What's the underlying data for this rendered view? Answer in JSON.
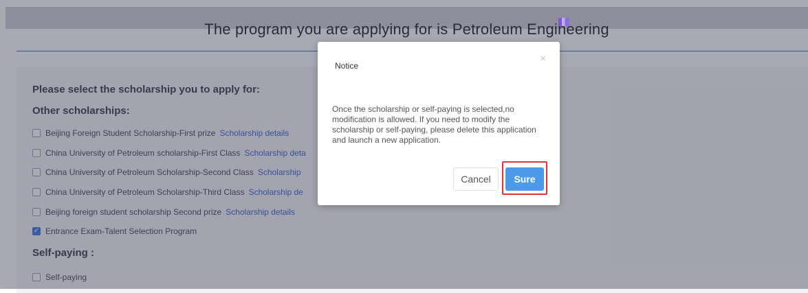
{
  "header": {
    "program_title": "The program you are applying for is Petroleum Engineering"
  },
  "form": {
    "prompt": "Please select the scholarship you to apply for:",
    "other_scholarships_heading": "Other scholarships:",
    "options": [
      {
        "label": "Beijing Foreign Student Scholarship-First prize",
        "link": "Scholarship details",
        "checked": false
      },
      {
        "label": "China University of Petroleum scholarship-First Class",
        "link": "Scholarship deta",
        "checked": false
      },
      {
        "label": "China University of Petroleum Scholarship-Second Class",
        "link": "Scholarship",
        "checked": false
      },
      {
        "label": "China University of Petroleum Scholarship-Third Class",
        "link": "Scholarship de",
        "checked": false
      },
      {
        "label": "Beijing foreign student scholarship Second prize",
        "link": "Scholarship details",
        "checked": false
      },
      {
        "label": "Entrance Exam-Talent Selection Program",
        "link": "",
        "checked": true
      }
    ],
    "self_paying_heading": "Self-paying :",
    "self_paying_option": {
      "label": "Self-paying",
      "checked": false
    }
  },
  "modal": {
    "title": "Notice",
    "close_icon": "×",
    "message": "Once the scholarship or self-paying is selected,no modification is allowed. If you need to modify the scholarship or self-paying, please delete this application and launch a new application.",
    "cancel_label": "Cancel",
    "sure_label": "Sure"
  },
  "colors": {
    "accent": "#4c9ae8",
    "link": "#3a66c4",
    "highlight": "#e03232",
    "check": "#3d7be0"
  }
}
